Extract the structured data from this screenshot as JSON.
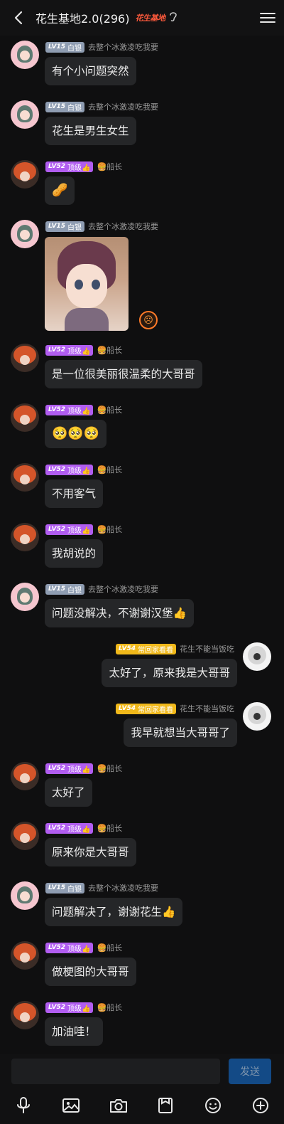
{
  "header": {
    "title": "花生基地2.0(296)",
    "brand_text": "花生基地",
    "back_icon": "chevron-left",
    "ear_icon": "ear",
    "menu_icon": "menu"
  },
  "badges": {
    "lv15": {
      "level": "LV15",
      "title": "白银"
    },
    "lv52": {
      "level": "LV52",
      "title": "顶级👍"
    },
    "lv54": {
      "level": "LV54",
      "title": "常回家看看"
    }
  },
  "users": {
    "u1": {
      "name": "去整个冰激凌吃我要"
    },
    "u2": {
      "name": "🍔船长"
    },
    "me": {
      "name": "花生不能当饭吃"
    }
  },
  "messages": [
    {
      "side": "left",
      "user": "u1",
      "text": "有个小问题突然"
    },
    {
      "side": "left",
      "user": "u1",
      "text": "花生是男生女生"
    },
    {
      "side": "left",
      "user": "u2",
      "text": "🥜"
    },
    {
      "side": "left",
      "user": "u1",
      "text": "",
      "image": "anime-girl-sticker",
      "badge_icon": "sticker-emoji-badge"
    },
    {
      "side": "left",
      "user": "u2",
      "text": "是一位很美丽很温柔的大哥哥"
    },
    {
      "side": "left",
      "user": "u2",
      "text": "🥺🥺🥺"
    },
    {
      "side": "left",
      "user": "u2",
      "text": "不用客气"
    },
    {
      "side": "left",
      "user": "u2",
      "text": "我胡说的"
    },
    {
      "side": "left",
      "user": "u1",
      "text": "问题没解决，不谢谢汉堡👍"
    },
    {
      "side": "right",
      "user": "me",
      "text": "太好了，原来我是大哥哥"
    },
    {
      "side": "right",
      "user": "me",
      "text": "我早就想当大哥哥了"
    },
    {
      "side": "left",
      "user": "u2",
      "text": "太好了"
    },
    {
      "side": "left",
      "user": "u2",
      "text": "原来你是大哥哥"
    },
    {
      "side": "left",
      "user": "u1",
      "text": "问题解决了，谢谢花生👍"
    },
    {
      "side": "left",
      "user": "u2",
      "text": "做梗图的大哥哥"
    },
    {
      "side": "left",
      "user": "u2",
      "text": "加油哇！"
    }
  ],
  "composer": {
    "input_value": "",
    "send_label": "发送"
  },
  "toolbar": {
    "icons": [
      "microphone-icon",
      "image-icon",
      "camera-icon",
      "sticker-icon",
      "emoji-icon",
      "plus-icon"
    ]
  },
  "colors": {
    "background": "#0f0f10",
    "bubble": "#252628",
    "send_button": "#134a86",
    "lv15": "#8f9db2",
    "lv52": "#b15df0",
    "lv54": "#f0b81a"
  }
}
